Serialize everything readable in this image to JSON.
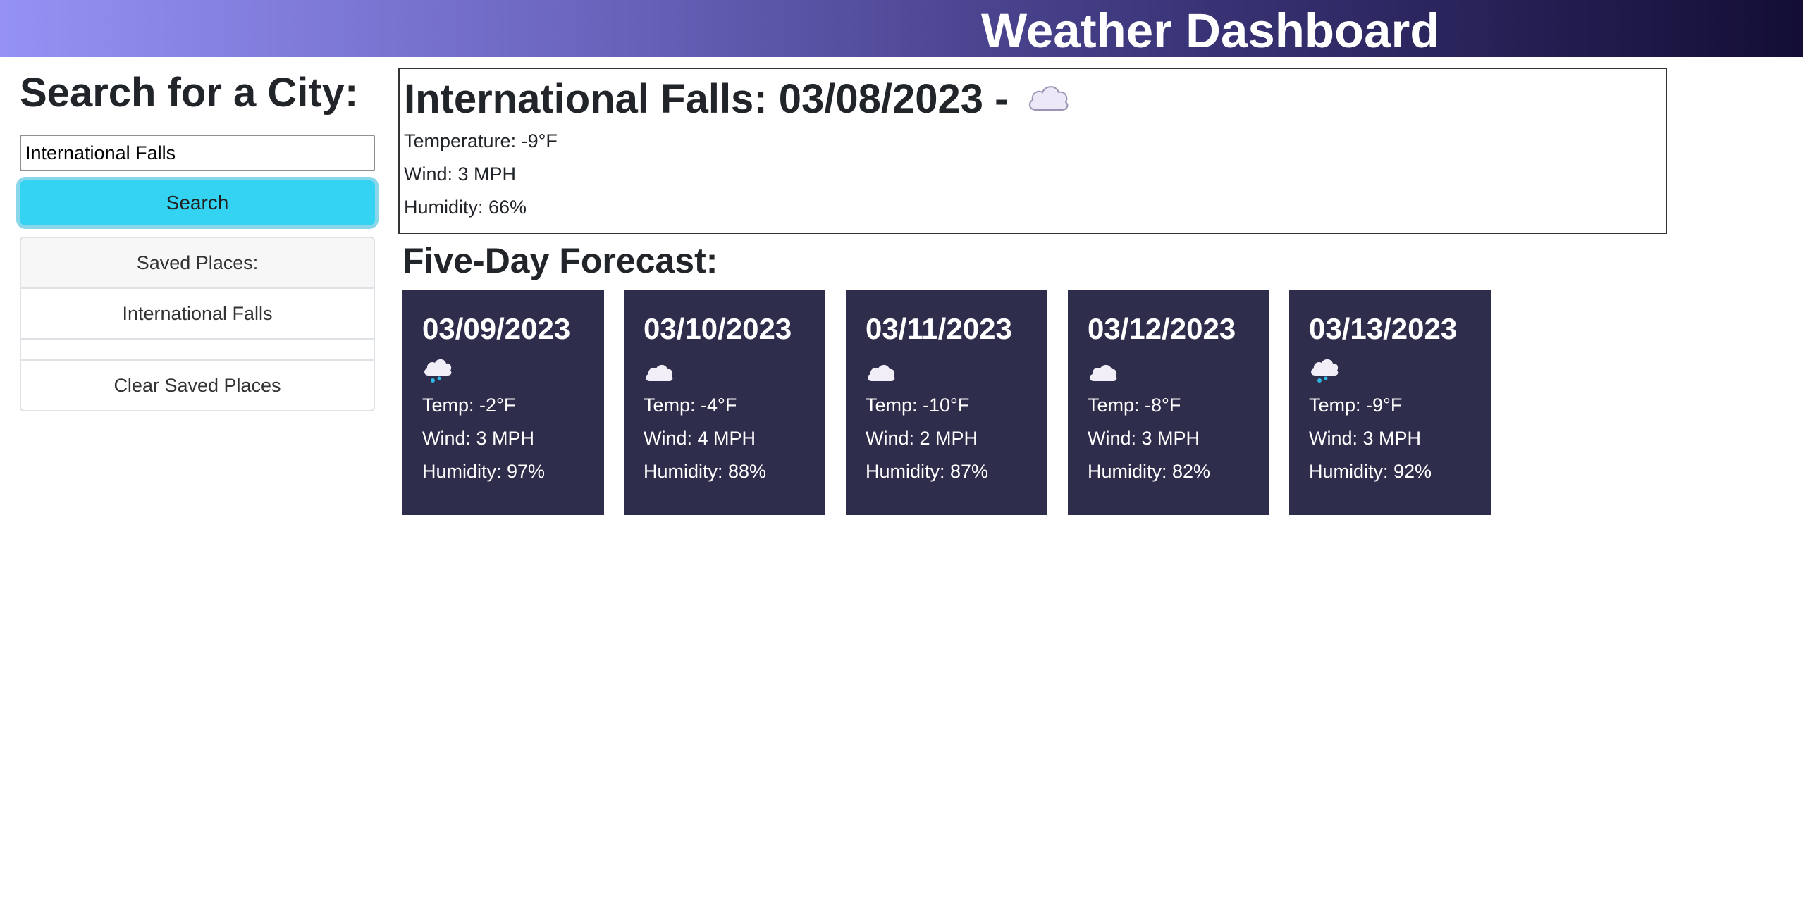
{
  "header": {
    "title": "Weather Dashboard"
  },
  "sidebar": {
    "heading": "Search for a City:",
    "search_value": "International Falls",
    "search_button": "Search",
    "saved_header": "Saved Places:",
    "saved_items": [
      "International Falls"
    ],
    "clear_button": "Clear Saved Places"
  },
  "current": {
    "title": "International Falls: 03/08/2023 -",
    "icon": "cloud-icon",
    "temperature": "Temperature: -9°F",
    "wind": "Wind: 3 MPH",
    "humidity": "Humidity: 66%"
  },
  "forecast": {
    "heading": "Five-Day Forecast:",
    "days": [
      {
        "date": "03/09/2023",
        "icon": "snow-icon",
        "temp": "Temp: -2°F",
        "wind": "Wind: 3 MPH",
        "humidity": "Humidity: 97%"
      },
      {
        "date": "03/10/2023",
        "icon": "cloud-icon",
        "temp": "Temp: -4°F",
        "wind": "Wind: 4 MPH",
        "humidity": "Humidity: 88%"
      },
      {
        "date": "03/11/2023",
        "icon": "cloud-icon",
        "temp": "Temp: -10°F",
        "wind": "Wind: 2 MPH",
        "humidity": "Humidity: 87%"
      },
      {
        "date": "03/12/2023",
        "icon": "cloud-icon",
        "temp": "Temp: -8°F",
        "wind": "Wind: 3 MPH",
        "humidity": "Humidity: 82%"
      },
      {
        "date": "03/13/2023",
        "icon": "snow-icon",
        "temp": "Temp: -9°F",
        "wind": "Wind: 3 MPH",
        "humidity": "Humidity: 92%"
      }
    ]
  },
  "colors": {
    "accent": "#35d3f2",
    "card_bg": "#2f2d4c",
    "header_start": "#9592f5",
    "header_end": "#130e35"
  }
}
